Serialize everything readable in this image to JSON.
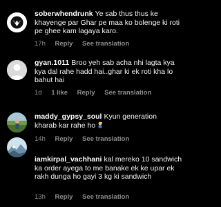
{
  "comments": [
    {
      "username": "soberwhendrunk",
      "text": "Ye sab thus thus ke khayenge par Ghar pe maa ko bolenge ki roti pe ghee kam lagaya karo.",
      "time": "17h",
      "likes": "",
      "reply_label": "Reply",
      "translate_label": "See translation",
      "avatar_icon": "skull-logo-avatar"
    },
    {
      "username": "gyan.1011",
      "text": "Broo yeh sab acha nhi lagta kya kya dal rahe hadd hai..ghar ki ek roti kha lo bahut hai",
      "time": "1d",
      "likes": "1 like",
      "reply_label": "Reply",
      "translate_label": "See translation",
      "avatar_icon": "default-person-avatar"
    },
    {
      "username": "maddy_gypsy_soul",
      "text": "Kyun generation kharab kar rahe ho",
      "time": "14h",
      "likes": "",
      "reply_label": "Reply",
      "translate_label": "See translation",
      "avatar_icon": "outdoor-photo-avatar",
      "trailing_emoji": "person-facepalming-emoji"
    },
    {
      "username": "iamkirpal_vachhani",
      "text": "kal mereko 10 sandwich ka order ayega to me banake ek ke upar ek rakh dunga ho gayi 3 kg ki sandwich",
      "time": "13h",
      "likes": "",
      "reply_label": "Reply",
      "translate_label": "See translation",
      "avatar_icon": "mountain-scene-avatar"
    }
  ],
  "colors": {
    "background": "#000000",
    "text": "#f5f5f5",
    "meta": "#8e8e8e"
  }
}
